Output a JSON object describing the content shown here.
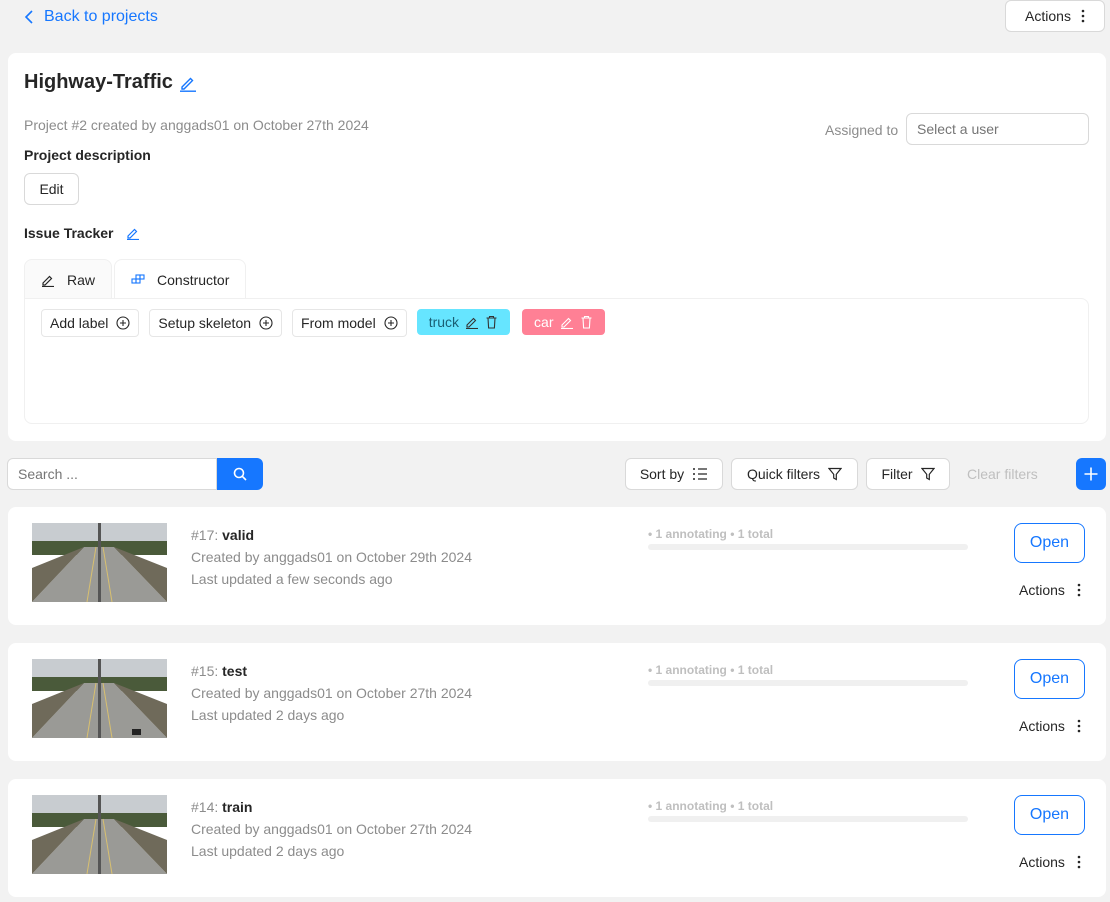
{
  "nav": {
    "back_label": "Back to projects",
    "actions_label": "Actions"
  },
  "project": {
    "title": "Highway-Traffic",
    "meta": "Project #2 created by anggads01 on October 27th 2024",
    "assigned_label": "Assigned to",
    "assigned_placeholder": "Select a user",
    "description_label": "Project description",
    "edit_label": "Edit",
    "issue_tracker_label": "Issue Tracker"
  },
  "tabs": [
    {
      "label": "Raw",
      "icon": "pencil-icon"
    },
    {
      "label": "Constructor",
      "icon": "blocks-icon"
    }
  ],
  "constructor": {
    "add_label": "Add label",
    "setup_skeleton": "Setup skeleton",
    "from_model": "From model",
    "labels": [
      {
        "name": "truck",
        "color": "#66e5ff"
      },
      {
        "name": "car",
        "color": "#ff8095"
      }
    ]
  },
  "toolbar": {
    "search_placeholder": "Search ...",
    "sort_by": "Sort by",
    "quick_filters": "Quick filters",
    "filter": "Filter",
    "clear_filters": "Clear filters"
  },
  "colors": {
    "accent": "#1677ff"
  },
  "tasks": [
    {
      "id": "#17: ",
      "name": "valid",
      "created": "Created by anggads01 on October 29th 2024",
      "updated": "Last updated a few seconds ago",
      "progress": "• 1 annotating • 1 total",
      "open": "Open",
      "actions": "Actions"
    },
    {
      "id": "#15: ",
      "name": "test",
      "created": "Created by anggads01 on October 27th 2024",
      "updated": "Last updated 2 days ago",
      "progress": "• 1 annotating • 1 total",
      "open": "Open",
      "actions": "Actions"
    },
    {
      "id": "#14: ",
      "name": "train",
      "created": "Created by anggads01 on October 27th 2024",
      "updated": "Last updated 2 days ago",
      "progress": "• 1 annotating • 1 total",
      "open": "Open",
      "actions": "Actions"
    }
  ]
}
